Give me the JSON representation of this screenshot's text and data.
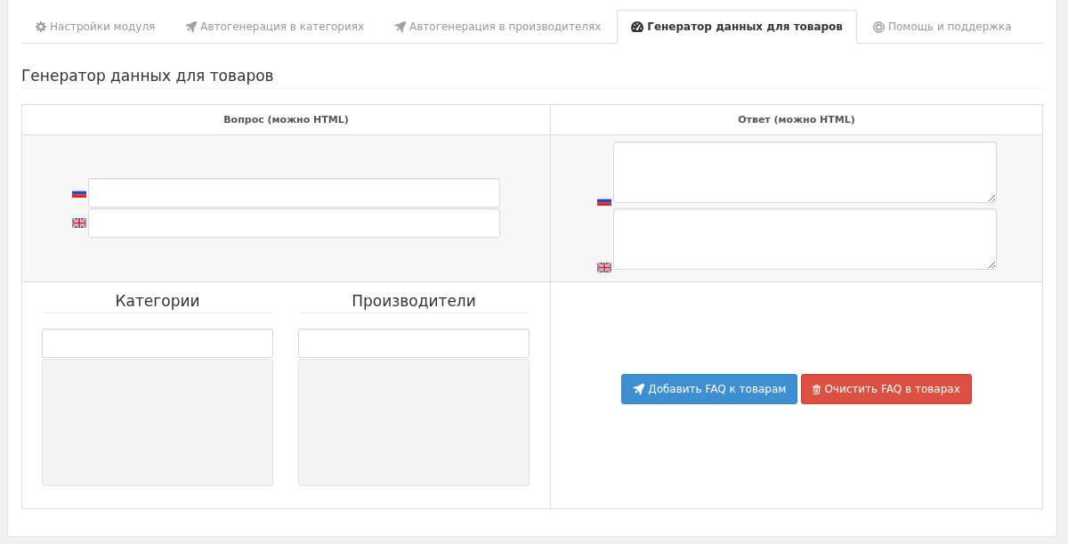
{
  "tabs": [
    {
      "label": "Настройки модуля",
      "kind": "settings",
      "selected": false
    },
    {
      "label": "Автогенерация в категориях",
      "kind": "autogen",
      "selected": false
    },
    {
      "label": "Автогенерация в производителях",
      "kind": "autogen",
      "selected": false
    },
    {
      "label": "Генератор данных для товаров",
      "kind": "generator",
      "selected": true
    },
    {
      "label": "Помощь и поддержка",
      "kind": "help",
      "selected": false
    }
  ],
  "section_title": "Генератор данных для товаров",
  "table": {
    "columns": [
      "Вопрос (можно HTML)",
      "Ответ (можно HTML)"
    ],
    "question_fields": [
      {
        "kind": "ru"
      },
      {
        "kind": "en"
      }
    ],
    "answer_fields": [
      {
        "kind": "ru"
      },
      {
        "kind": "en"
      }
    ],
    "filters": [
      {
        "title": "Категории"
      },
      {
        "title": "Производители"
      }
    ],
    "buttons": [
      {
        "label": "Добавить FAQ к товарам",
        "kind": "primary"
      },
      {
        "label": "Очистить FAQ в товарах",
        "kind": "danger"
      }
    ]
  }
}
